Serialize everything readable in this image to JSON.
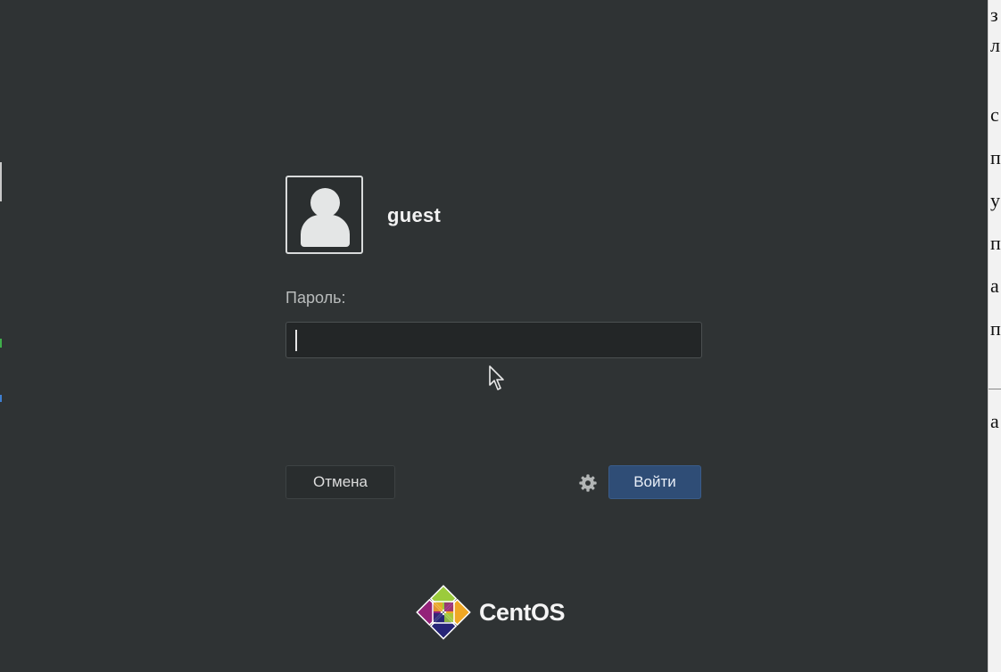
{
  "login": {
    "username": "guest",
    "password_label": "Пароль:",
    "password_value": ""
  },
  "buttons": {
    "cancel_label": "Отмена",
    "login_label": "Войти"
  },
  "icons": {
    "avatar": "user-silhouette-icon",
    "session_settings": "gear-icon",
    "pointer": "mouse-cursor-icon"
  },
  "branding": {
    "logo_text": "CentOS"
  },
  "colors": {
    "background": "#2f3334",
    "primary_button": "#2f4d76",
    "input_background": "#232627",
    "text": "#f2f2f2",
    "muted_text": "#b9bcbc"
  }
}
